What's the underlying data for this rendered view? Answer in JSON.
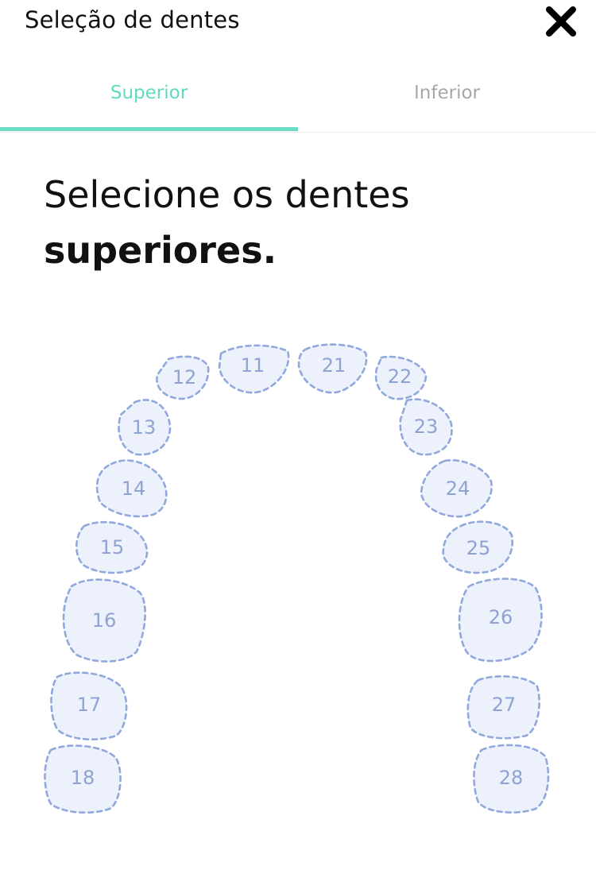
{
  "header": {
    "title": "Seleção de dentes",
    "close_icon": "close-x-icon"
  },
  "tabs": [
    {
      "label": "Superior",
      "active": true
    },
    {
      "label": "Inferior",
      "active": false
    }
  ],
  "colors": {
    "accent": "#5fdcc0",
    "inactive_tab": "#a8a8a8",
    "tooth_fill": "#edf1fb",
    "tooth_stroke": "#90a8dc",
    "tooth_label": "#8ea3d2"
  },
  "heading": {
    "line1": "Selecione os dentes",
    "line2": "superiores."
  },
  "teeth": [
    {
      "number": "11"
    },
    {
      "number": "12"
    },
    {
      "number": "13"
    },
    {
      "number": "14"
    },
    {
      "number": "15"
    },
    {
      "number": "16"
    },
    {
      "number": "17"
    },
    {
      "number": "18"
    },
    {
      "number": "21"
    },
    {
      "number": "22"
    },
    {
      "number": "23"
    },
    {
      "number": "24"
    },
    {
      "number": "25"
    },
    {
      "number": "26"
    },
    {
      "number": "27"
    },
    {
      "number": "28"
    }
  ]
}
